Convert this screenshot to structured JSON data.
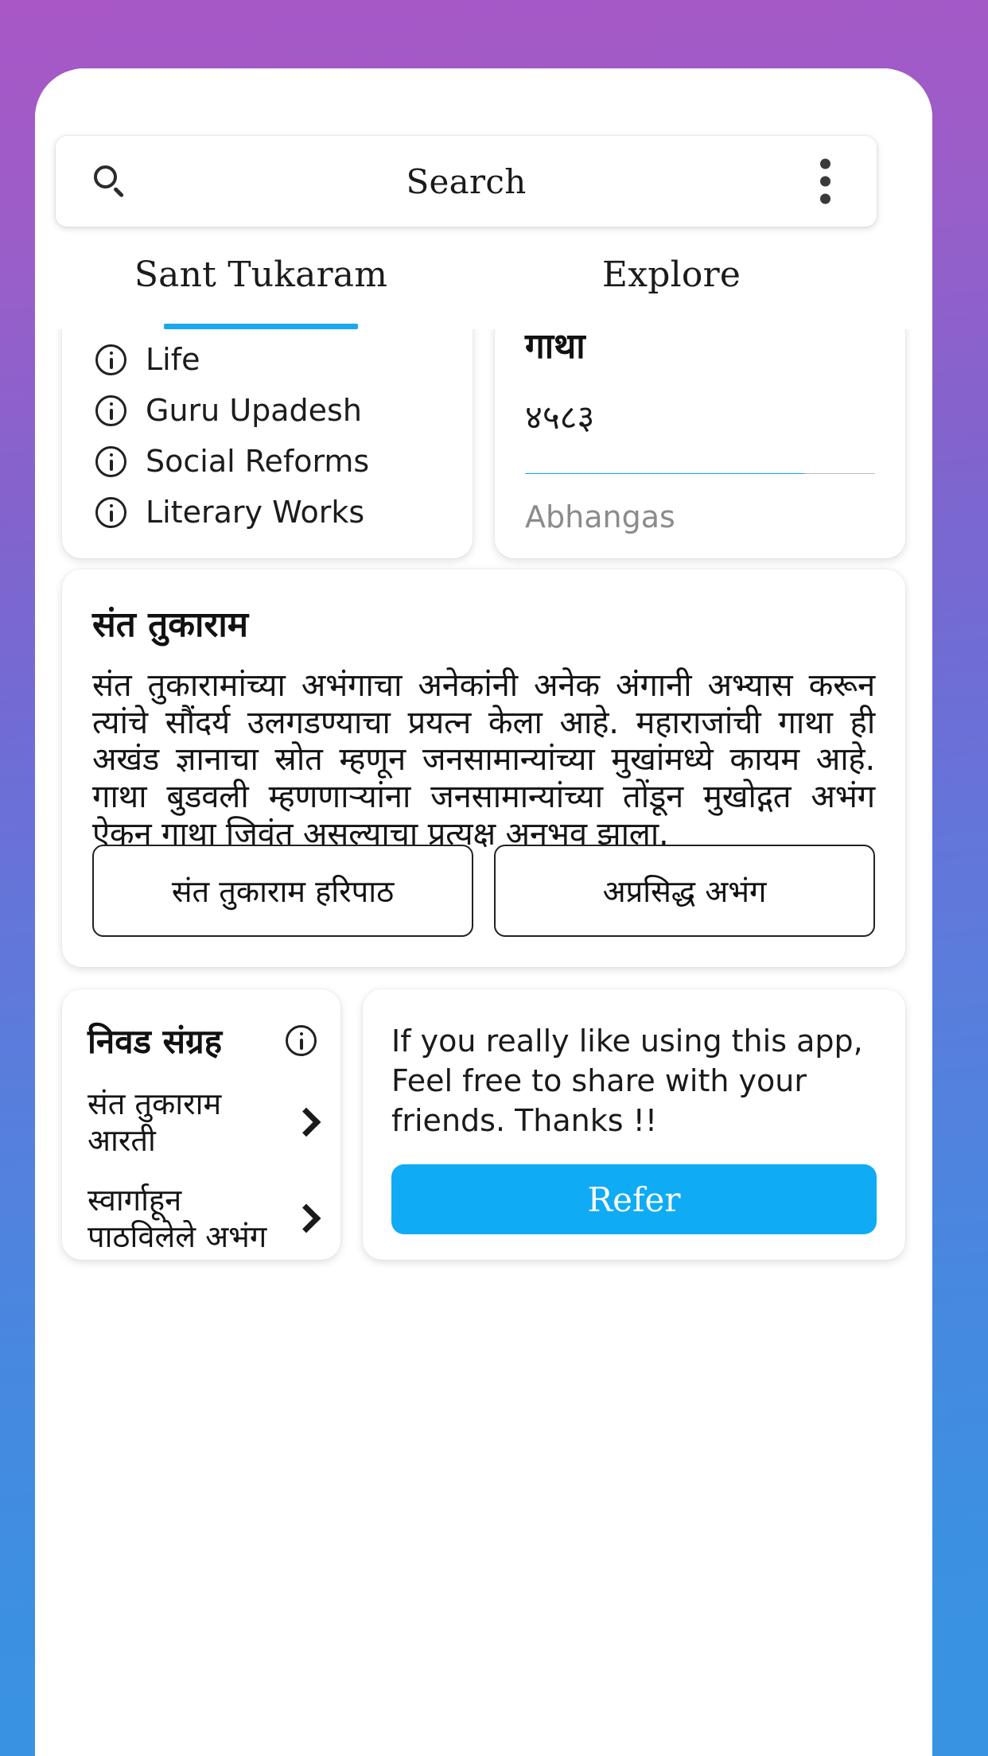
{
  "colors": {
    "accent": "#11a7ef",
    "refer_button": "#0fabf5",
    "gradient_top": "#a857c6",
    "gradient_bottom": "#3894e3"
  },
  "search": {
    "placeholder": "Search",
    "search_icon": "search-icon",
    "overflow_icon": "more-vert-icon"
  },
  "tabs": [
    {
      "label": "Sant Tukaram",
      "active": true
    },
    {
      "label": "Explore",
      "active": false
    }
  ],
  "topics_card": {
    "items": [
      {
        "label": "Life",
        "icon": "info-icon"
      },
      {
        "label": "Guru Upadesh",
        "icon": "info-icon"
      },
      {
        "label": "Social Reforms",
        "icon": "info-icon"
      },
      {
        "label": "Literary Works",
        "icon": "info-icon"
      }
    ]
  },
  "gatha_card": {
    "title": "गाथा",
    "count": "४५८३",
    "progress_percent": 80,
    "subtitle": "Abhangas"
  },
  "main_card": {
    "title": "संत तुकाराम",
    "body": "संत तुकारामांच्या अभंगाचा अनेकांनी अनेक अंगानी अभ्यास करून त्यांचे सौंदर्य उलगडण्याचा प्रयत्न केला आहे. महाराजांची गाथा ही अखंड ज्ञानाचा स्रोत म्हणून जनसामान्यांच्या मुखांमध्ये कायम आहे. गाथा बुडवली म्हणणाऱ्यांना जनसामान्यांच्या तोंडून मुखोद्गत अभंग ऐकून गाथा जिवंत असल्याचा प्रत्यक्ष अनुभव झाला.",
    "buttons": [
      {
        "label": "संत तुकाराम हरिपाठ"
      },
      {
        "label": "अप्रसिद्ध अभंग"
      }
    ]
  },
  "collection_card": {
    "title": "निवड संग्रह",
    "info_icon": "info-icon",
    "rows": [
      {
        "label": "संत तुकाराम आरती",
        "icon": "chevron-right-icon"
      },
      {
        "label": "स्वार्गाहून पाठविलेले अभंग",
        "icon": "chevron-right-icon"
      }
    ]
  },
  "refer_card": {
    "text": "If you really like using this app, Feel free to share with your friends. Thanks !!",
    "button_label": "Refer"
  }
}
